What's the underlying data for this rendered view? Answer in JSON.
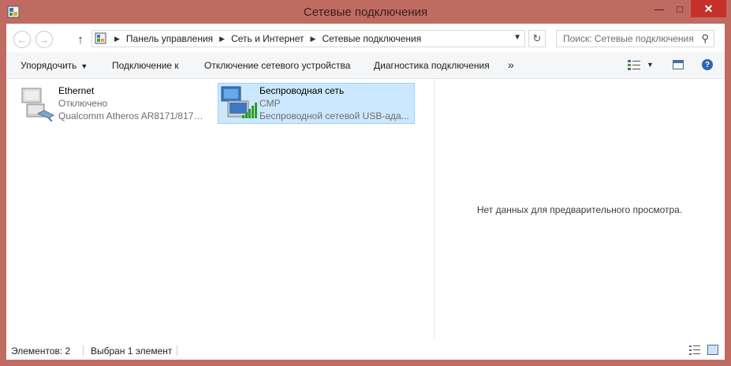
{
  "window": {
    "title": "Сетевые подключения",
    "controls": {
      "minimize": "—",
      "maximize": "□",
      "close": "✕"
    }
  },
  "address_bar": {
    "breadcrumbs": [
      "Панель управления",
      "Сеть и Интернет",
      "Сетевые подключения"
    ],
    "search_placeholder": "Поиск: Сетевые подключения"
  },
  "command_bar": {
    "organize": "Упорядочить",
    "connect_to": "Подключение к",
    "disable_device": "Отключение сетевого устройства",
    "diagnose": "Диагностика подключения",
    "more": "»"
  },
  "connections": [
    {
      "name": "Ethernet",
      "status": "Отключено",
      "device": "Qualcomm Atheros AR8171/8175 ...",
      "selected": false
    },
    {
      "name": "Беспроводная сеть",
      "status": "CMP",
      "device": "Беспроводной сетевой USB-ада...",
      "selected": true
    }
  ],
  "preview_pane": {
    "message": "Нет данных для предварительного просмотра."
  },
  "status_bar": {
    "item_count": "Элементов: 2",
    "selected": "Выбран 1 элемент"
  },
  "colors": {
    "frame": "#c06b62",
    "close_button": "#c7302a",
    "selection_bg": "#cce8ff",
    "selection_border": "#99d1ff"
  }
}
